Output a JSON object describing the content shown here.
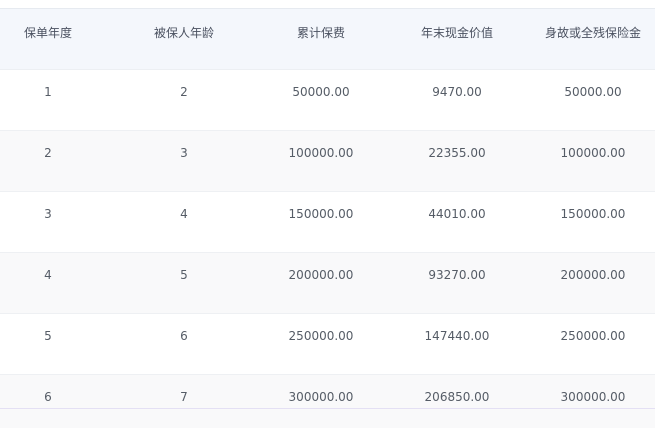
{
  "columns": [
    "保单年度",
    "被保人年龄",
    "累计保费",
    "年末现金价值",
    "身故或全残保险金"
  ],
  "rows": [
    [
      "1",
      "2",
      "50000.00",
      "9470.00",
      "50000.00"
    ],
    [
      "2",
      "3",
      "100000.00",
      "22355.00",
      "100000.00"
    ],
    [
      "3",
      "4",
      "150000.00",
      "44010.00",
      "150000.00"
    ],
    [
      "4",
      "5",
      "200000.00",
      "93270.00",
      "200000.00"
    ],
    [
      "5",
      "6",
      "250000.00",
      "147440.00",
      "250000.00"
    ],
    [
      "6",
      "7",
      "300000.00",
      "206850.00",
      "300000.00"
    ]
  ],
  "colors": {
    "header_bg": "#f4f7fc",
    "row_alt_bg": "#f9f9fa",
    "row_bg": "#ffffff",
    "text": "#555c66"
  }
}
